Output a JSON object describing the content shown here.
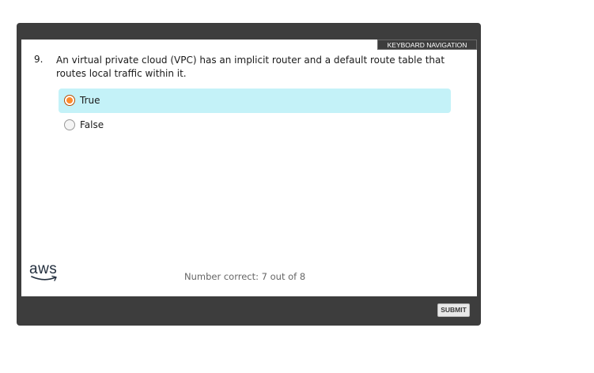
{
  "toolbar": {
    "keyboard_navigation": "KEYBOARD NAVIGATION"
  },
  "question": {
    "number": "9.",
    "text": "An virtual private cloud (VPC) has an implicit router and a default route table that routes local traffic within it.",
    "options": [
      {
        "label": "True",
        "selected": true
      },
      {
        "label": "False",
        "selected": false
      }
    ]
  },
  "footer": {
    "logo_text": "aws",
    "score_text": "Number correct: 7 out of 8",
    "submit_label": "SUBMIT"
  },
  "colors": {
    "frame": "#3d3d3d",
    "selected_option_bg": "#c4f2f8",
    "radio_accent": "#ff8a2a"
  }
}
